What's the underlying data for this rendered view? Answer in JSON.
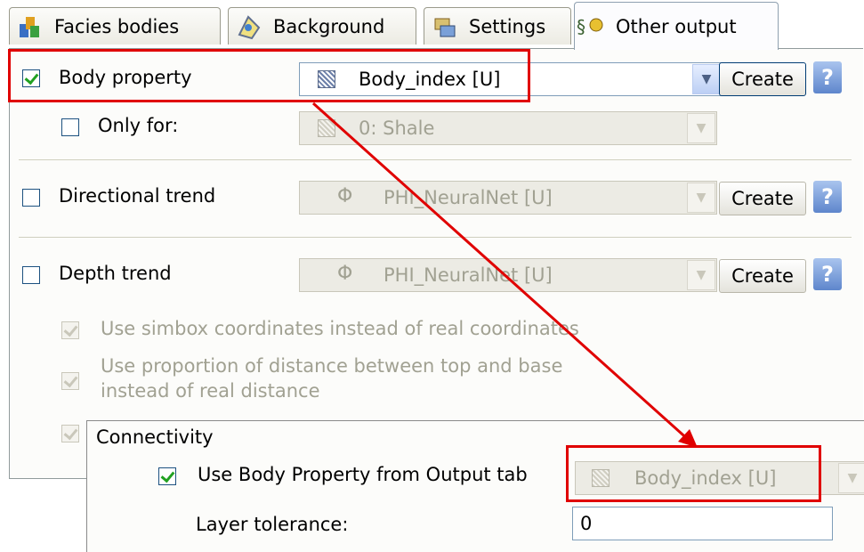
{
  "tabs": [
    {
      "label": "Facies bodies",
      "icon": "facies-bodies-icon"
    },
    {
      "label": "Background",
      "icon": "background-icon"
    },
    {
      "label": "Settings",
      "icon": "settings-icon"
    },
    {
      "label": "Other output",
      "icon": "other-output-icon",
      "active": true
    }
  ],
  "body_property": {
    "label": "Body property",
    "checked": true,
    "value": "Body_index [U]",
    "create_label": "Create",
    "help_label": "?"
  },
  "only_for": {
    "label": "Only for:",
    "checked": false,
    "value": "0: Shale"
  },
  "directional_trend": {
    "label": "Directional trend",
    "checked": false,
    "value": "PHI_NeuralNet [U]",
    "create_label": "Create",
    "help_label": "?"
  },
  "depth_trend": {
    "label": "Depth trend",
    "checked": false,
    "value": "PHI_NeuralNet [U]",
    "create_label": "Create",
    "help_label": "?"
  },
  "options": {
    "simbox_label": "Use simbox coordinates instead of real coordinates",
    "proportion_label_line1": "Use proportion of distance between top and base",
    "proportion_label_line2": "instead of real distance"
  },
  "connectivity": {
    "title": "Connectivity",
    "use_body_label": "Use Body Property from Output tab",
    "use_body_checked": true,
    "body_value": "Body_index [U]",
    "layer_tolerance_label": "Layer tolerance:",
    "layer_tolerance_value": "0"
  },
  "phi_symbol": "Φ",
  "colors": {
    "highlight": "#e00000",
    "arrow": "#e00000"
  }
}
